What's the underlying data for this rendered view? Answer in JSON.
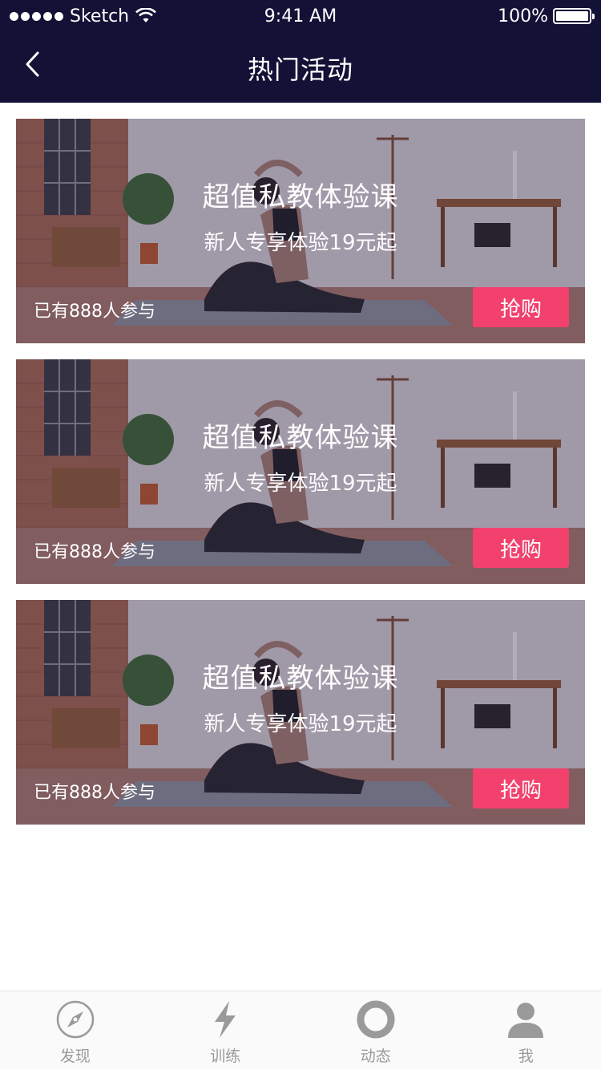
{
  "status_bar": {
    "carrier": "Sketch",
    "time": "9:41 AM",
    "battery": "100%"
  },
  "nav": {
    "title": "热门活动",
    "back_icon": "chevron-left-icon"
  },
  "cards": [
    {
      "title": "超值私教体验课",
      "subtitle": "新人专享体验19元起",
      "participants": "已有888人参与",
      "button": "抢购"
    },
    {
      "title": "超值私教体验课",
      "subtitle": "新人专享体验19元起",
      "participants": "已有888人参与",
      "button": "抢购"
    },
    {
      "title": "超值私教体验课",
      "subtitle": "新人专享体验19元起",
      "participants": "已有888人参与",
      "button": "抢购"
    }
  ],
  "tabbar": {
    "items": [
      {
        "label": "发现",
        "icon": "compass-icon"
      },
      {
        "label": "训练",
        "icon": "lightning-icon"
      },
      {
        "label": "动态",
        "icon": "ring-icon"
      },
      {
        "label": "我",
        "icon": "user-icon"
      }
    ]
  },
  "colors": {
    "header_bg": "#131136",
    "accent": "#f2416d",
    "tab_inactive": "#9a9a9a"
  }
}
